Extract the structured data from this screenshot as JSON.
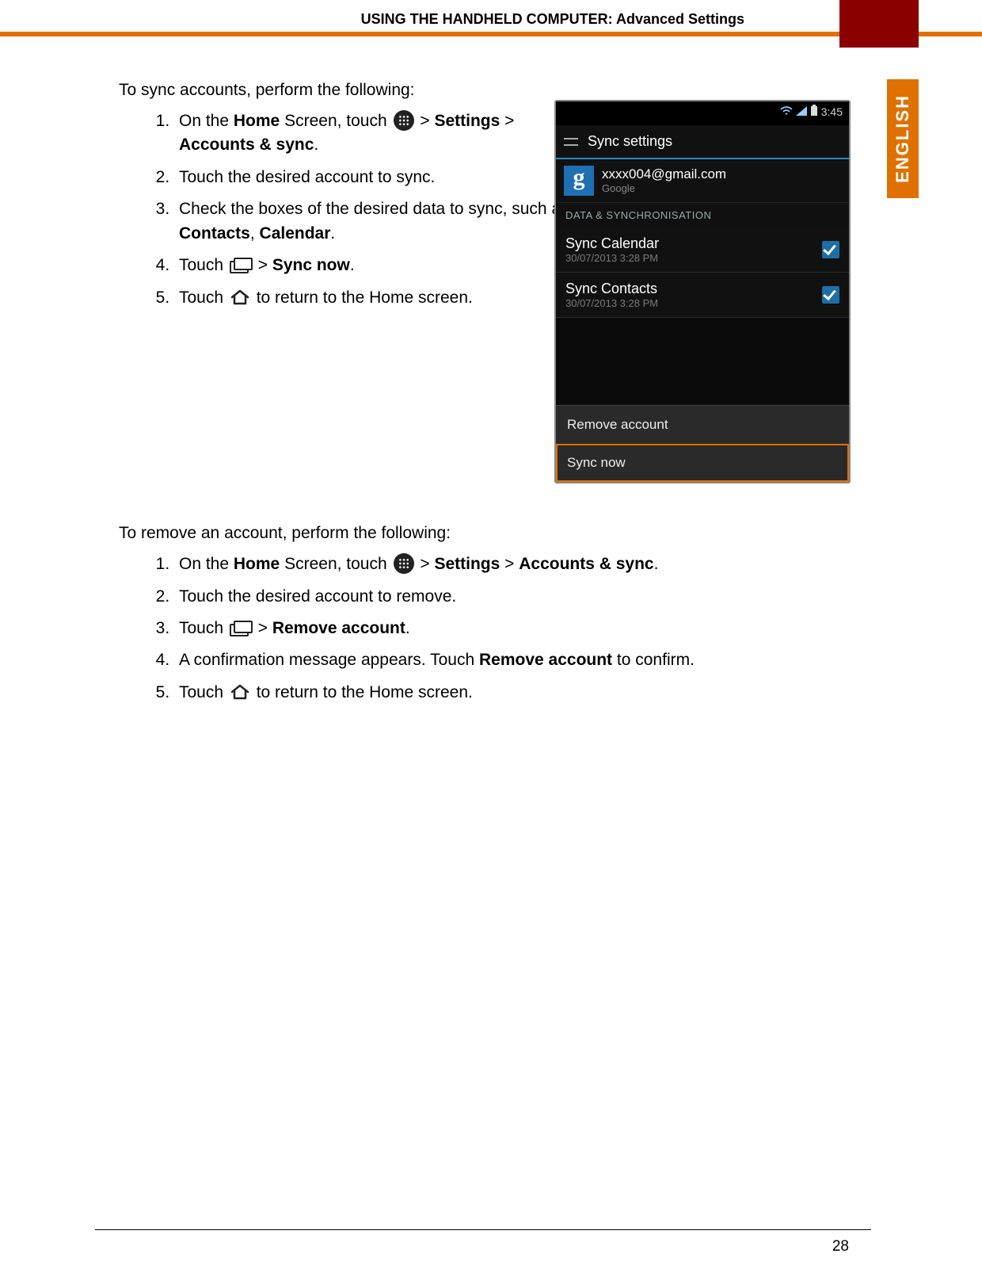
{
  "header": {
    "title": "USING THE HANDHELD COMPUTER: Advanced Settings",
    "language_tab": "ENGLISH",
    "page_number": "28"
  },
  "section1": {
    "intro": "To sync accounts, perform the following:",
    "steps": {
      "s1a": "On the ",
      "s1b": "Home",
      "s1c": " Screen, touch ",
      "s1d": " > ",
      "s1e": "Settings",
      "s1f": " > ",
      "s1g": "Accounts & sync",
      "s1h": ".",
      "s2": "Touch the desired account to sync.",
      "s3a": "Check the boxes of the desired data to sync, such as ",
      "s3b": "Contacts",
      "s3c": ", ",
      "s3d": "Calendar",
      "s3e": ".",
      "s4a": "Touch ",
      "s4b": " > ",
      "s4c": "Sync now",
      "s4d": ".",
      "s5a": "Touch ",
      "s5b": " to return to the Home screen."
    }
  },
  "section2": {
    "intro": "To remove an account, perform the following:",
    "steps": {
      "s1a": "On the ",
      "s1b": "Home",
      "s1c": " Screen, touch ",
      "s1d": " > ",
      "s1e": "Settings",
      "s1f": " > ",
      "s1g": "Accounts & sync",
      "s1h": ".",
      "s2": "Touch the desired account to remove.",
      "s3a": "Touch ",
      "s3b": " > ",
      "s3c": "Remove account",
      "s3d": ".",
      "s4a": "A confirmation message appears. Touch ",
      "s4b": "Remove account",
      "s4c": " to confirm.",
      "s5a": "Touch ",
      "s5b": " to return to the Home screen."
    }
  },
  "phone": {
    "time": "3:45",
    "title": "Sync settings",
    "email": "xxxx004@gmail.com",
    "provider": "Google",
    "section_label": "DATA & SYNCHRONISATION",
    "rows": [
      {
        "title": "Sync Calendar",
        "date": "30/07/2013 3:28 PM"
      },
      {
        "title": "Sync Contacts",
        "date": "30/07/2013 3:28 PM"
      }
    ],
    "menu": {
      "remove": "Remove account",
      "sync_now": "Sync now"
    }
  }
}
